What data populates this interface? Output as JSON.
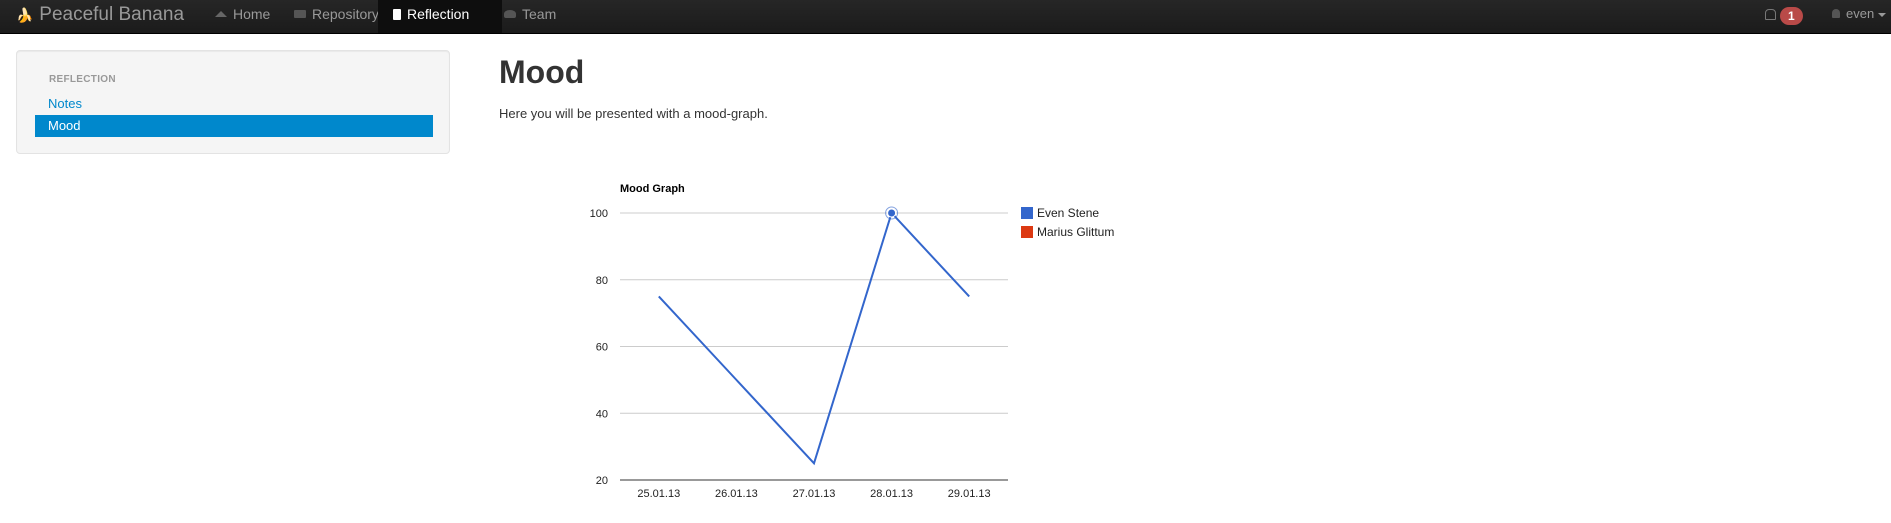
{
  "navbar": {
    "brand": "Peaceful Banana",
    "items": [
      {
        "label": "Home",
        "icon": "home-icon"
      },
      {
        "label": "Repository",
        "icon": "folder-icon"
      },
      {
        "label": "Reflection",
        "icon": "book-icon",
        "active": true
      },
      {
        "label": "Team",
        "icon": "team-icon"
      }
    ],
    "notification_count": "1",
    "user": "even"
  },
  "sidebar": {
    "header": "REFLECTION",
    "items": [
      {
        "label": "Notes",
        "active": false
      },
      {
        "label": "Mood",
        "active": true
      }
    ]
  },
  "main": {
    "title": "Mood",
    "description": "Here you will be presented with a mood-graph."
  },
  "colors": {
    "accent": "#0088cc",
    "badge": "#b94a48",
    "series_even": "#3366cc",
    "series_marius": "#dc3912"
  },
  "chart_data": {
    "type": "line",
    "title": "Mood Graph",
    "categories": [
      "25.01.13",
      "26.01.13",
      "27.01.13",
      "28.01.13",
      "29.01.13"
    ],
    "ylim": [
      20,
      100
    ],
    "yticks": [
      20,
      40,
      60,
      80,
      100
    ],
    "grid": true,
    "legend": "right",
    "series": [
      {
        "name": "Even Stene",
        "color": "#3366cc",
        "values": [
          75,
          50,
          25,
          100,
          75
        ]
      },
      {
        "name": "Marius Glittum",
        "color": "#dc3912",
        "values": [
          null,
          null,
          null,
          null,
          null
        ]
      }
    ],
    "highlight": {
      "series": 0,
      "index": 3
    }
  }
}
